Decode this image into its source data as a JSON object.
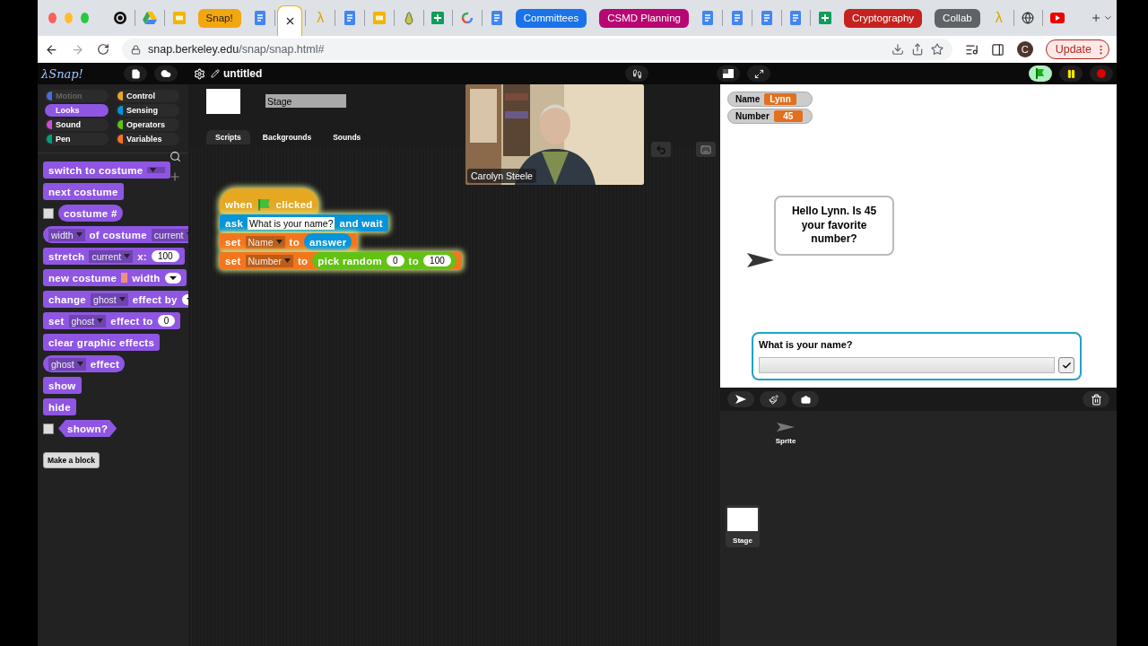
{
  "browser": {
    "tabs": [
      {
        "kind": "circle-s",
        "selected": false
      },
      {
        "kind": "drive",
        "selected": false
      },
      {
        "kind": "slides",
        "selected": false
      },
      {
        "kind": "group",
        "label": "Snap!",
        "color": "#f2a60f",
        "selected": false
      },
      {
        "kind": "docs",
        "selected": false
      },
      {
        "kind": "blank",
        "selected": true
      },
      {
        "kind": "glyph",
        "glyph": "λ",
        "selected": false
      },
      {
        "kind": "docs",
        "selected": false
      },
      {
        "kind": "slides",
        "selected": false
      },
      {
        "kind": "pear",
        "selected": false
      },
      {
        "kind": "sheets",
        "selected": false
      },
      {
        "kind": "google",
        "selected": false
      },
      {
        "kind": "docs",
        "selected": false
      },
      {
        "kind": "group",
        "label": "Committees",
        "color": "#1a73e8",
        "selected": false
      },
      {
        "kind": "group",
        "label": "CSMD Planning",
        "color": "#b80672",
        "selected": false
      },
      {
        "kind": "docs",
        "selected": false
      },
      {
        "kind": "docs",
        "selected": false
      },
      {
        "kind": "docs",
        "selected": false
      },
      {
        "kind": "docs",
        "selected": false
      },
      {
        "kind": "sheets",
        "selected": false
      },
      {
        "kind": "group",
        "label": "Cryptography",
        "color": "#c5221f",
        "selected": false
      },
      {
        "kind": "group",
        "label": "Collab",
        "color": "#5f6368",
        "selected": false
      },
      {
        "kind": "glyph",
        "glyph": "λ",
        "selected": false
      },
      {
        "kind": "globe",
        "selected": false
      },
      {
        "kind": "video",
        "selected": false
      }
    ],
    "address": {
      "host": "snap.berkeley.edu",
      "path": "/snap/snap.html#"
    },
    "profile_initial": "C",
    "update_label": "Update"
  },
  "snap": {
    "logo": "λSnap!",
    "project_title": "untitled",
    "categories": [
      {
        "label": "Motion",
        "color": "#4a6cd4",
        "selected": false,
        "disabled": true
      },
      {
        "label": "Control",
        "color": "#e6a822",
        "selected": false,
        "disabled": false
      },
      {
        "label": "Looks",
        "color": "#8f56e3",
        "selected": true,
        "disabled": false
      },
      {
        "label": "Sensing",
        "color": "#0494dc",
        "selected": false,
        "disabled": false
      },
      {
        "label": "Sound",
        "color": "#cf4ad9",
        "selected": false,
        "disabled": false
      },
      {
        "label": "Operators",
        "color": "#62c213",
        "selected": false,
        "disabled": false
      },
      {
        "label": "Pen",
        "color": "#00a178",
        "selected": false,
        "disabled": false
      },
      {
        "label": "Variables",
        "color": "#f3761d",
        "selected": false,
        "disabled": false
      }
    ],
    "palette": [
      {
        "kind": "command",
        "color": "#8f56e3",
        "parts": [
          {
            "kind": "text",
            "text": "switch to costume"
          },
          {
            "kind": "menu"
          }
        ]
      },
      {
        "kind": "command",
        "color": "#8f56e3",
        "parts": [
          {
            "kind": "text",
            "text": "next costume"
          }
        ]
      },
      {
        "kind": "reporter",
        "color": "#8f56e3",
        "checked": false,
        "parts": [
          {
            "kind": "text",
            "text": "costume #"
          }
        ]
      },
      {
        "kind": "reporter",
        "color": "#8f56e3",
        "parts": [
          {
            "kind": "menu",
            "text": "width"
          },
          {
            "kind": "text",
            "text": "of costume"
          },
          {
            "kind": "menu",
            "text": "current"
          }
        ]
      },
      {
        "kind": "command",
        "color": "#8f56e3",
        "parts": [
          {
            "kind": "text",
            "text": "stretch"
          },
          {
            "kind": "menu",
            "text": "current"
          },
          {
            "kind": "text",
            "text": "x:"
          },
          {
            "kind": "num",
            "text": "100"
          }
        ]
      },
      {
        "kind": "command",
        "color": "#8f56e3",
        "parts": [
          {
            "kind": "text",
            "text": "new costume"
          },
          {
            "kind": "list-icon"
          },
          {
            "kind": "text",
            "text": "width"
          },
          {
            "kind": "num-menu"
          }
        ]
      },
      {
        "kind": "command",
        "color": "#8f56e3",
        "parts": [
          {
            "kind": "text",
            "text": "change"
          },
          {
            "kind": "menu",
            "text": "ghost"
          },
          {
            "kind": "text",
            "text": "effect by"
          },
          {
            "kind": "num-menu"
          }
        ]
      },
      {
        "kind": "command",
        "color": "#8f56e3",
        "parts": [
          {
            "kind": "text",
            "text": "set"
          },
          {
            "kind": "menu",
            "text": "ghost"
          },
          {
            "kind": "text",
            "text": "effect to"
          },
          {
            "kind": "num",
            "text": "0"
          }
        ]
      },
      {
        "kind": "command",
        "color": "#8f56e3",
        "parts": [
          {
            "kind": "text",
            "text": "clear graphic effects"
          }
        ]
      },
      {
        "kind": "reporter",
        "color": "#8f56e3",
        "parts": [
          {
            "kind": "menu",
            "text": "ghost"
          },
          {
            "kind": "text",
            "text": "effect"
          }
        ]
      },
      {
        "kind": "command",
        "color": "#8f56e3",
        "parts": [
          {
            "kind": "text",
            "text": "show"
          }
        ]
      },
      {
        "kind": "command",
        "color": "#8f56e3",
        "parts": [
          {
            "kind": "text",
            "text": "hide"
          }
        ]
      },
      {
        "kind": "predicate",
        "color": "#8f56e3",
        "checked": false,
        "parts": [
          {
            "kind": "text",
            "text": "shown?"
          }
        ]
      }
    ],
    "make_block": "Make a block",
    "sprite_bar": {
      "name": "Stage",
      "tabs": [
        {
          "label": "Scripts",
          "selected": true
        },
        {
          "label": "Backgrounds",
          "selected": false
        },
        {
          "label": "Sounds",
          "selected": false
        }
      ]
    },
    "video": {
      "kind": "picture",
      "caption": "Carolyn Steele"
    },
    "script": {
      "running": true,
      "blocks": [
        {
          "kind": "hat",
          "color": "#e6a822",
          "parts": [
            {
              "kind": "text",
              "text": "when"
            },
            {
              "kind": "flag"
            },
            {
              "kind": "text",
              "text": "clicked"
            }
          ]
        },
        {
          "kind": "command",
          "color": "#0494dc",
          "parts": [
            {
              "kind": "text",
              "text": "ask"
            },
            {
              "kind": "slot",
              "text": "What is your name?"
            },
            {
              "kind": "text",
              "text": "and wait"
            }
          ]
        },
        {
          "kind": "command",
          "color": "#f3761d",
          "parts": [
            {
              "kind": "text",
              "text": "set"
            },
            {
              "kind": "menu",
              "text": "Name"
            },
            {
              "kind": "text",
              "text": "to"
            },
            {
              "kind": "reporter",
              "color": "#0494dc",
              "parts": [
                {
                  "kind": "text",
                  "text": "answer"
                }
              ]
            }
          ]
        },
        {
          "kind": "command",
          "color": "#f3761d",
          "parts": [
            {
              "kind": "text",
              "text": "set"
            },
            {
              "kind": "menu",
              "text": "Number"
            },
            {
              "kind": "text",
              "text": "to"
            },
            {
              "kind": "reporter",
              "color": "#62c213",
              "parts": [
                {
                  "kind": "text",
                  "text": "pick random"
                },
                {
                  "kind": "num",
                  "text": "0"
                },
                {
                  "kind": "text",
                  "text": "to"
                },
                {
                  "kind": "num",
                  "text": "100"
                }
              ]
            }
          ]
        }
      ]
    },
    "stage": {
      "watchers": [
        {
          "label": "Name",
          "value": "Lynn"
        },
        {
          "label": "Number",
          "value": "45"
        }
      ],
      "speech": "Hello Lynn. Is 45 your favorite number?",
      "prompt": {
        "question": "What is your name?"
      }
    },
    "corral": {
      "sprites": [
        {
          "name": "Sprite",
          "selected": false
        }
      ],
      "stage": {
        "name": "Stage",
        "selected": true
      }
    }
  }
}
